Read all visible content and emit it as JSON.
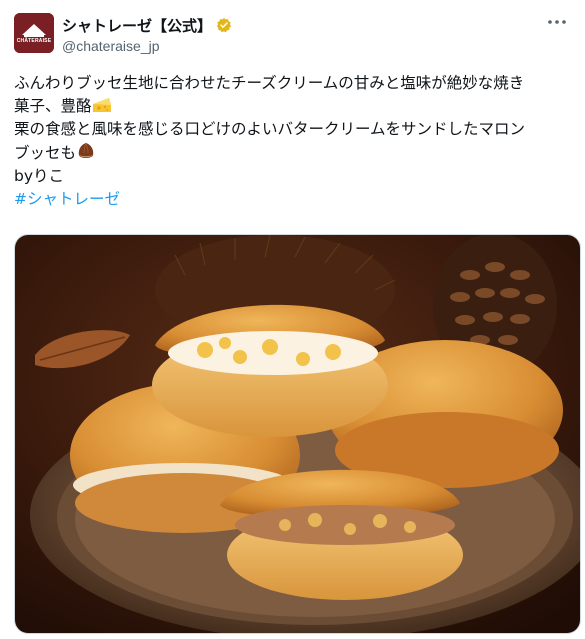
{
  "account": {
    "display_name": "シャトレーゼ【公式】",
    "handle": "@chateraise_jp",
    "avatar_logo_text": "CHÂTERAISE",
    "verified_badge": "gold-verified-badge-icon",
    "brand_color": "#7a1f24"
  },
  "menu": {
    "more_icon": "more-horizontal-icon"
  },
  "post": {
    "line1": "ふんわりブッセ生地に合わせたチーズクリームの甘みと塩味が絶妙な焼き",
    "line2": "菓子、豊酪",
    "line3": "栗の食感と風味を感じる口どけのよいバタークリームをサンドしたマロン",
    "line4": "ブッセも",
    "line5": "byりこ",
    "hashtag": "#シャトレーゼ",
    "emoji_1": "cheese-icon",
    "emoji_2": "chestnut-icon"
  },
  "media": {
    "alt": "photo-of-buche-pastries-on-plate"
  },
  "colors": {
    "text": "#0f1419",
    "secondary": "#536471",
    "link": "#1d9bf0"
  }
}
